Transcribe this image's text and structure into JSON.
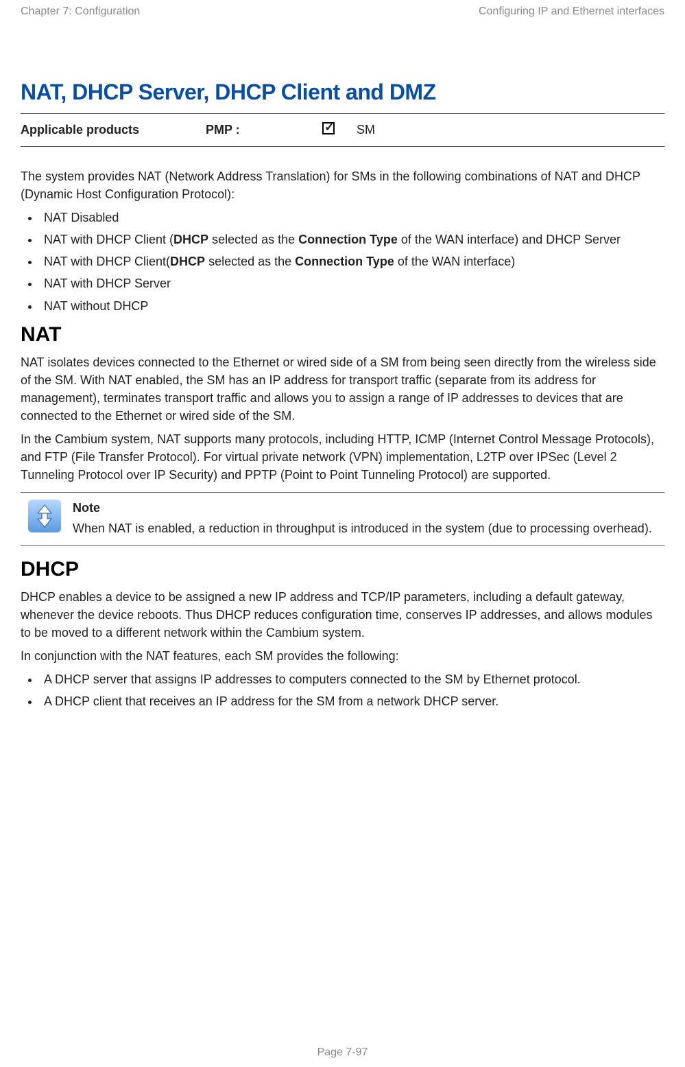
{
  "header": {
    "left": "Chapter 7:  Configuration",
    "right": "Configuring IP and Ethernet interfaces"
  },
  "title": "NAT, DHCP Server, DHCP Client and DMZ",
  "applicable": {
    "label": "Applicable products",
    "pmp_label": "PMP :",
    "sm_label": "SM"
  },
  "intro": "The system provides NAT (Network Address Translation) for SMs in the following combinations of NAT and DHCP (Dynamic Host Configuration Protocol):",
  "combos": [
    {
      "pre": "NAT Disabled"
    },
    {
      "pre": "NAT with DHCP Client (",
      "bold1": "DHCP",
      "mid1": " selected as the ",
      "bold2": "Connection Type",
      "post": " of the WAN interface) and DHCP Server"
    },
    {
      "pre": "NAT with DHCP Client(",
      "bold1": "DHCP",
      "mid1": " selected as the ",
      "bold2": "Connection Type",
      "post": " of the WAN interface)"
    },
    {
      "pre": "NAT with DHCP Server"
    },
    {
      "pre": "NAT without DHCP"
    }
  ],
  "nat": {
    "heading": "NAT",
    "p1": "NAT isolates devices connected to the Ethernet or wired side of a SM from being seen directly from the wireless side of the SM. With NAT enabled, the SM has an IP address for transport traffic (separate from its address for management), terminates transport traffic and allows you to assign a range of IP addresses to devices that are connected to the Ethernet or wired side of the SM.",
    "p2": "In the Cambium system, NAT supports many protocols, including HTTP, ICMP (Internet Control Message Protocols), and FTP (File Transfer Protocol). For virtual private network (VPN) implementation, L2TP over IPSec (Level 2 Tunneling Protocol over IP Security) and PPTP (Point to Point Tunneling Protocol) are supported."
  },
  "note": {
    "heading": "Note",
    "body": "When NAT is enabled, a reduction in throughput is introduced in the system (due to processing overhead)."
  },
  "dhcp": {
    "heading": "DHCP",
    "p1": "DHCP enables a device to be assigned a new IP address and TCP/IP parameters, including a default gateway, whenever the device reboots. Thus DHCP reduces configuration time, conserves IP addresses, and allows modules to be moved to a different network within the Cambium system.",
    "p2": "In conjunction with the NAT features, each SM provides the following:",
    "list": [
      "A DHCP server that assigns IP addresses to computers connected to the SM by Ethernet protocol.",
      "A DHCP client that receives an IP address for the SM from a network DHCP server."
    ]
  },
  "footer": "Page 7-97"
}
